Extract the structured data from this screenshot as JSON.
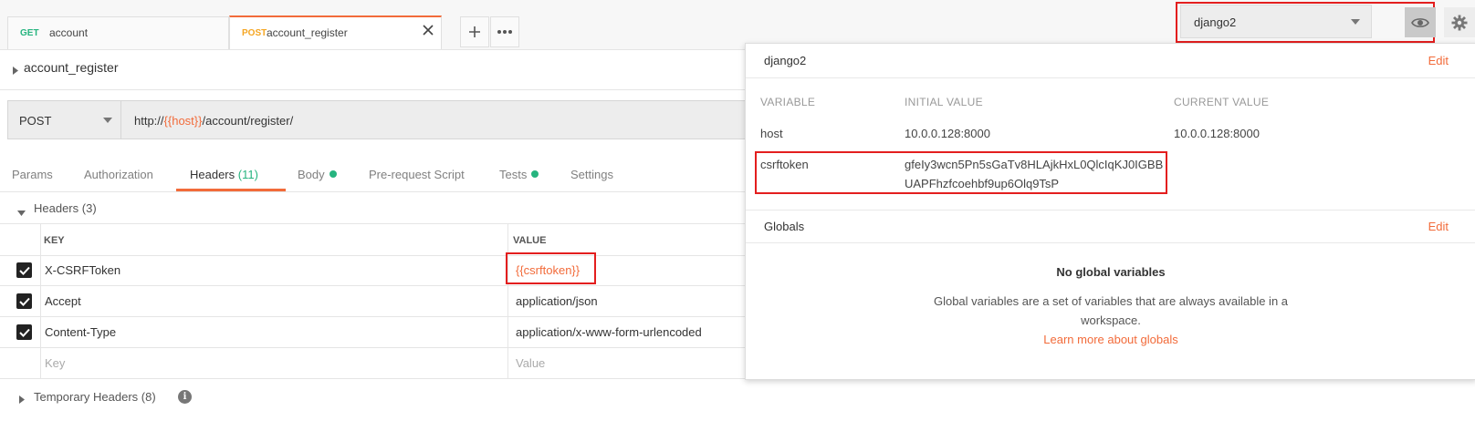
{
  "tabs": [
    {
      "method": "GET",
      "method_color": "#26b47f",
      "name": "account"
    },
    {
      "method": "POST",
      "method_color": "#f5a623",
      "name": "account_register"
    }
  ],
  "tab_icons": [
    "plus-icon",
    "more-icon"
  ],
  "environment": {
    "selected": "django2"
  },
  "request": {
    "name": "account_register",
    "method": "POST",
    "url_prefix": "http://",
    "url_var": "{{host}}",
    "url_suffix": "/account/register/"
  },
  "request_tabs": [
    {
      "label": "Params"
    },
    {
      "label": "Authorization"
    },
    {
      "label": "Headers",
      "count": "(11)"
    },
    {
      "label": "Body"
    },
    {
      "label": "Pre-request Script"
    },
    {
      "label": "Tests"
    },
    {
      "label": "Settings"
    }
  ],
  "headers_section": {
    "title": "Headers",
    "count": "(3)",
    "col_key": "KEY",
    "col_value": "VALUE",
    "rows": [
      {
        "key": "X-CSRFToken",
        "value": "{{csrftoken}}"
      },
      {
        "key": "Accept",
        "value": "application/json"
      },
      {
        "key": "Content-Type",
        "value": "application/x-www-form-urlencoded"
      }
    ],
    "key_placeholder": "Key",
    "value_placeholder": "Value"
  },
  "temp_headers": {
    "title": "Temporary Headers",
    "count": "(8)"
  },
  "env_popover": {
    "env_name": "django2",
    "edit_label": "Edit",
    "columns": [
      "VARIABLE",
      "INITIAL VALUE",
      "CURRENT VALUE"
    ],
    "variables": [
      {
        "name": "host",
        "initial": "10.0.0.128:8000",
        "current": "10.0.0.128:8000"
      },
      {
        "name": "csrftoken",
        "initial_line1": "gfeIy3wcn5Pn5sGaTv8HLAjkHxL0QlcIqKJ0IGBB",
        "initial_line2": "UAPFhzfcoehbf9up6Olq9TsP",
        "current": ""
      }
    ],
    "globals_title": "Globals",
    "globals_edit": "Edit",
    "no_globals": "No global variables",
    "globals_desc_1": "Global variables are a set of variables that are always available in a",
    "globals_desc_2": "workspace.",
    "learn_more": "Learn more about globals"
  },
  "colors": {
    "accent": "#f26b3a",
    "highlight": "#e31e1e",
    "green": "#26b47f",
    "post": "#f5a623"
  }
}
